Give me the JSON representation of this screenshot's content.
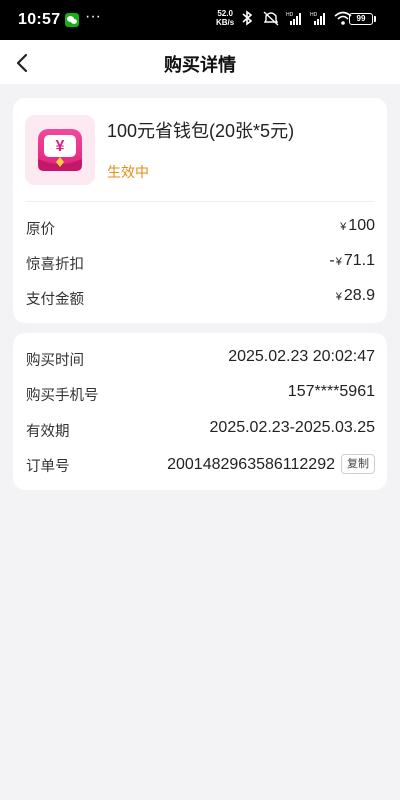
{
  "status_bar": {
    "time": "10:57",
    "dots": "···",
    "net_speed_value": "52.0",
    "net_speed_unit": "KB/s",
    "battery": "99",
    "icons": [
      "wechat-icon",
      "bluetooth-icon",
      "mute-icon",
      "signal-hd-icon",
      "signal-hd-icon",
      "wifi-icon",
      "battery-icon"
    ]
  },
  "nav": {
    "title": "购买详情",
    "back_icon": "chevron-left-icon"
  },
  "product": {
    "title": "100元省钱包(20张*5元)",
    "status": "生效中",
    "status_color": "#e58d15",
    "icon": "wallet-yen-icon",
    "price_rows": [
      {
        "label": "原价",
        "sign": "",
        "currency": "¥",
        "amount": "100"
      },
      {
        "label": "惊喜折扣",
        "sign": "-",
        "currency": "¥",
        "amount": "71.1"
      },
      {
        "label": "支付金额",
        "sign": "",
        "currency": "¥",
        "amount": "28.9"
      }
    ]
  },
  "order": {
    "rows": [
      {
        "label": "购买时间",
        "value": "2025.02.23 20:02:47"
      },
      {
        "label": "购买手机号",
        "value": "157****5961"
      },
      {
        "label": "有效期",
        "value": "2025.02.23-2025.03.25"
      },
      {
        "label": "订单号",
        "value": "2001482963586112292"
      }
    ],
    "copy_label": "复制"
  }
}
